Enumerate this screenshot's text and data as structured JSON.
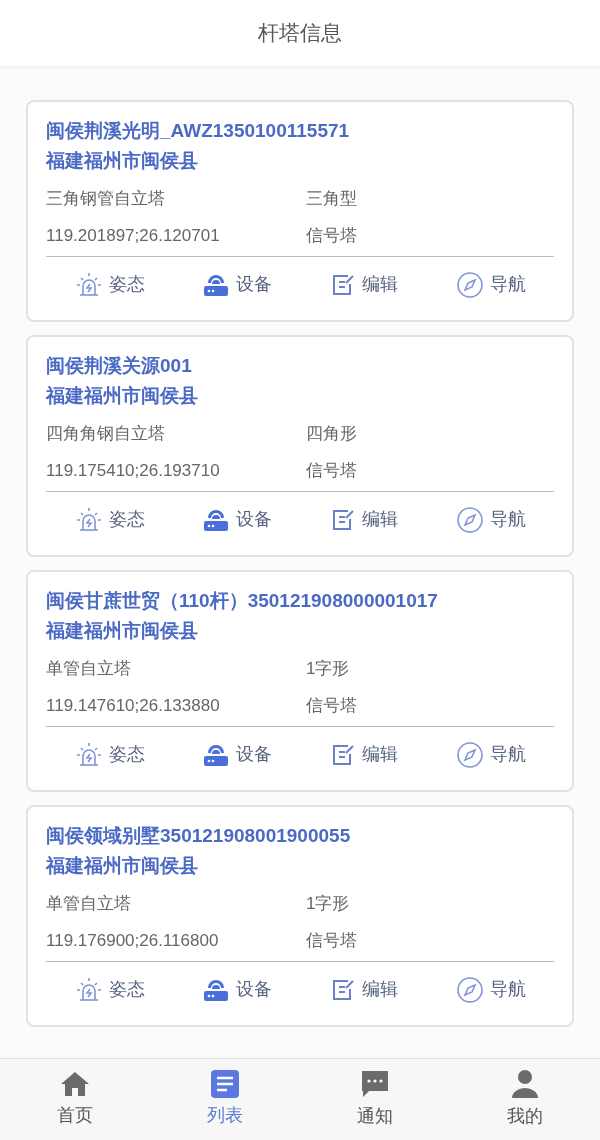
{
  "header": {
    "title": "杆塔信息"
  },
  "towers": [
    {
      "name": "闽侯荆溪光明_AWZ1350100115571",
      "address": "福建福州市闽侯县",
      "structure": "三角钢管自立塔",
      "shape": "三角型",
      "coordinates": "119.201897;26.120701",
      "type": "信号塔",
      "actions": [
        {
          "kind": "posture",
          "label": "姿态"
        },
        {
          "kind": "device",
          "label": "设备"
        },
        {
          "kind": "edit",
          "label": "编辑"
        },
        {
          "kind": "navigate",
          "label": "导航"
        }
      ]
    },
    {
      "name": "闽侯荆溪关源001",
      "address": "福建福州市闽侯县",
      "structure": "四角角钢自立塔",
      "shape": "四角形",
      "coordinates": "119.175410;26.193710",
      "type": "信号塔",
      "actions": [
        {
          "kind": "posture",
          "label": "姿态"
        },
        {
          "kind": "device",
          "label": "设备"
        },
        {
          "kind": "edit",
          "label": "编辑"
        },
        {
          "kind": "navigate",
          "label": "导航"
        }
      ]
    },
    {
      "name": "闽侯甘蔗世贸（110杆）350121908000001017",
      "address": "福建福州市闽侯县",
      "structure": "单管自立塔",
      "shape": "1字形",
      "coordinates": "119.147610;26.133880",
      "type": "信号塔",
      "actions": [
        {
          "kind": "posture",
          "label": "姿态"
        },
        {
          "kind": "device",
          "label": "设备"
        },
        {
          "kind": "edit",
          "label": "编辑"
        },
        {
          "kind": "navigate",
          "label": "导航"
        }
      ]
    },
    {
      "name": "闽侯领域别墅350121908001900055",
      "address": "福建福州市闽侯县",
      "structure": "单管自立塔",
      "shape": "1字形",
      "coordinates": "119.176900;26.116800",
      "type": "信号塔",
      "actions": [
        {
          "kind": "posture",
          "label": "姿态"
        },
        {
          "kind": "device",
          "label": "设备"
        },
        {
          "kind": "edit",
          "label": "编辑"
        },
        {
          "kind": "navigate",
          "label": "导航"
        }
      ]
    }
  ],
  "tab_bar": [
    {
      "kind": "home",
      "label": "首页",
      "selected": false
    },
    {
      "kind": "list",
      "label": "列表",
      "selected": true
    },
    {
      "kind": "notice",
      "label": "通知",
      "selected": false
    },
    {
      "kind": "profile",
      "label": "我的",
      "selected": false
    }
  ]
}
